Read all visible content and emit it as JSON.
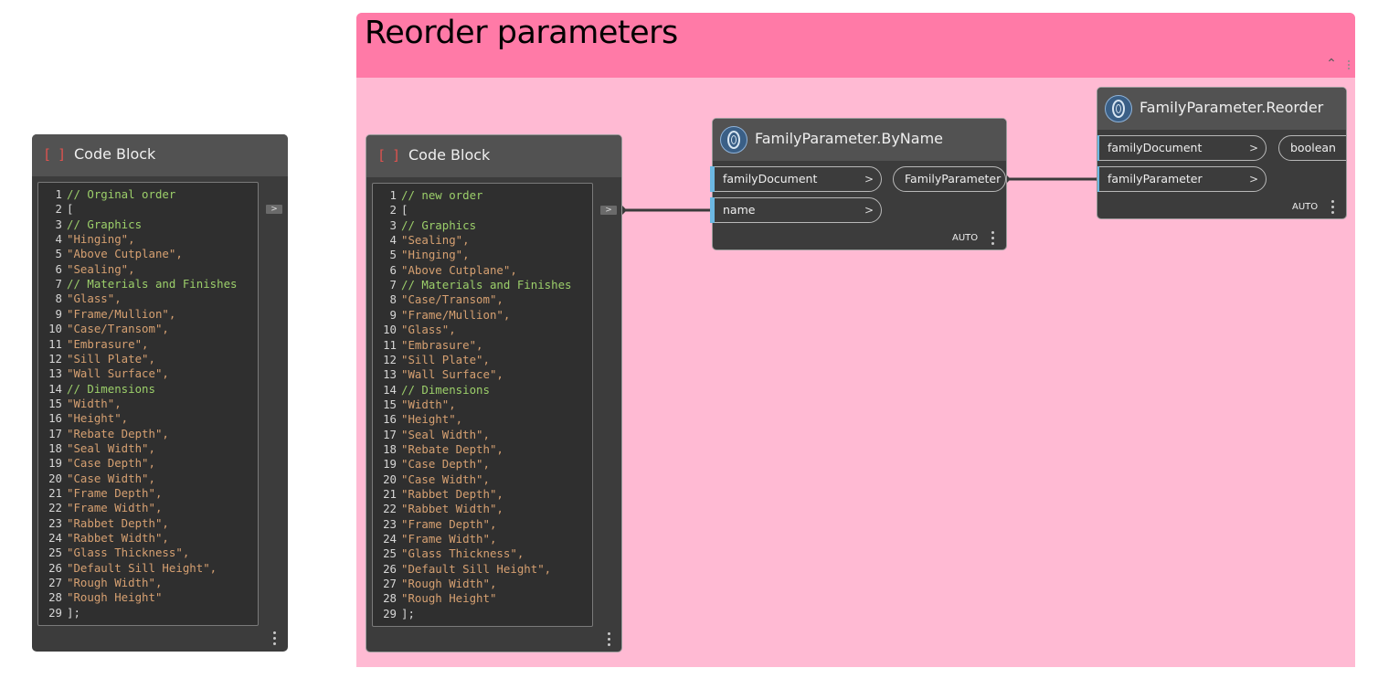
{
  "group": {
    "title": "Reorder parameters"
  },
  "nodes": {
    "code_left": {
      "title": "Code Block",
      "icon_open": "[",
      "icon_close": "]",
      "out_port": ">",
      "lines": [
        {
          "n": "1",
          "t": "// Orginal order",
          "k": "c-com"
        },
        {
          "n": "2",
          "t": "[",
          "k": "c-pun"
        },
        {
          "n": "3",
          "t": "// Graphics",
          "k": "c-com"
        },
        {
          "n": "4",
          "t": "\"Hinging\",",
          "k": "c-str"
        },
        {
          "n": "5",
          "t": "\"Above Cutplane\",",
          "k": "c-str"
        },
        {
          "n": "6",
          "t": "\"Sealing\",",
          "k": "c-str"
        },
        {
          "n": "7",
          "t": "// Materials and Finishes",
          "k": "c-com"
        },
        {
          "n": "8",
          "t": "\"Glass\",",
          "k": "c-str"
        },
        {
          "n": "9",
          "t": "\"Frame/Mullion\",",
          "k": "c-str"
        },
        {
          "n": "10",
          "t": "\"Case/Transom\",",
          "k": "c-str"
        },
        {
          "n": "11",
          "t": "\"Embrasure\",",
          "k": "c-str"
        },
        {
          "n": "12",
          "t": "\"Sill Plate\",",
          "k": "c-str"
        },
        {
          "n": "13",
          "t": "\"Wall Surface\",",
          "k": "c-str"
        },
        {
          "n": "14",
          "t": "// Dimensions",
          "k": "c-com"
        },
        {
          "n": "15",
          "t": "\"Width\",",
          "k": "c-str"
        },
        {
          "n": "16",
          "t": "\"Height\",",
          "k": "c-str"
        },
        {
          "n": "17",
          "t": "\"Rebate Depth\",",
          "k": "c-str"
        },
        {
          "n": "18",
          "t": "\"Seal Width\",",
          "k": "c-str"
        },
        {
          "n": "19",
          "t": "\"Case Depth\",",
          "k": "c-str"
        },
        {
          "n": "20",
          "t": "\"Case Width\",",
          "k": "c-str"
        },
        {
          "n": "21",
          "t": "\"Frame Depth\",",
          "k": "c-str"
        },
        {
          "n": "22",
          "t": "\"Frame Width\",",
          "k": "c-str"
        },
        {
          "n": "23",
          "t": "\"Rabbet Depth\",",
          "k": "c-str"
        },
        {
          "n": "24",
          "t": "\"Rabbet Width\",",
          "k": "c-str"
        },
        {
          "n": "25",
          "t": "\"Glass Thickness\",",
          "k": "c-str"
        },
        {
          "n": "26",
          "t": "\"Default Sill Height\",",
          "k": "c-str"
        },
        {
          "n": "27",
          "t": "\"Rough Width\",",
          "k": "c-str"
        },
        {
          "n": "28",
          "t": "\"Rough Height\"",
          "k": "c-str"
        },
        {
          "n": "29",
          "t": "];",
          "k": "c-pun"
        }
      ]
    },
    "code_right": {
      "title": "Code Block",
      "icon_open": "[",
      "icon_close": "]",
      "out_port": ">",
      "lines": [
        {
          "n": "1",
          "t": "// new order",
          "k": "c-com"
        },
        {
          "n": "2",
          "t": "[",
          "k": "c-pun"
        },
        {
          "n": "3",
          "t": "// Graphics",
          "k": "c-com"
        },
        {
          "n": "4",
          "t": "\"Sealing\",",
          "k": "c-str"
        },
        {
          "n": "5",
          "t": "\"Hinging\",",
          "k": "c-str"
        },
        {
          "n": "6",
          "t": "\"Above Cutplane\",",
          "k": "c-str"
        },
        {
          "n": "7",
          "t": "// Materials and Finishes",
          "k": "c-com"
        },
        {
          "n": "8",
          "t": "\"Case/Transom\",",
          "k": "c-str"
        },
        {
          "n": "9",
          "t": "\"Frame/Mullion\",",
          "k": "c-str"
        },
        {
          "n": "10",
          "t": "\"Glass\",",
          "k": "c-str"
        },
        {
          "n": "11",
          "t": "\"Embrasure\",",
          "k": "c-str"
        },
        {
          "n": "12",
          "t": "\"Sill Plate\",",
          "k": "c-str"
        },
        {
          "n": "13",
          "t": "\"Wall Surface\",",
          "k": "c-str"
        },
        {
          "n": "14",
          "t": "// Dimensions",
          "k": "c-com"
        },
        {
          "n": "15",
          "t": "\"Width\",",
          "k": "c-str"
        },
        {
          "n": "16",
          "t": "\"Height\",",
          "k": "c-str"
        },
        {
          "n": "17",
          "t": "\"Seal Width\",",
          "k": "c-str"
        },
        {
          "n": "18",
          "t": "\"Rebate Depth\",",
          "k": "c-str"
        },
        {
          "n": "19",
          "t": "\"Case Depth\",",
          "k": "c-str"
        },
        {
          "n": "20",
          "t": "\"Case Width\",",
          "k": "c-str"
        },
        {
          "n": "21",
          "t": "\"Rabbet Depth\",",
          "k": "c-str"
        },
        {
          "n": "22",
          "t": "\"Rabbet Width\",",
          "k": "c-str"
        },
        {
          "n": "23",
          "t": "\"Frame Depth\",",
          "k": "c-str"
        },
        {
          "n": "24",
          "t": "\"Frame Width\",",
          "k": "c-str"
        },
        {
          "n": "25",
          "t": "\"Glass Thickness\",",
          "k": "c-str"
        },
        {
          "n": "26",
          "t": "\"Default Sill Height\",",
          "k": "c-str"
        },
        {
          "n": "27",
          "t": "\"Rough Width\",",
          "k": "c-str"
        },
        {
          "n": "28",
          "t": "\"Rough Height\"",
          "k": "c-str"
        },
        {
          "n": "29",
          "t": "];",
          "k": "c-pun"
        }
      ]
    },
    "by_name": {
      "title": "FamilyParameter.ByName",
      "icon": "dynamo-revit-icon",
      "inputs": [
        "familyDocument",
        "name"
      ],
      "output": "FamilyParameter",
      "lacing": "AUTO"
    },
    "reorder": {
      "title": "FamilyParameter.Reorder",
      "icon": "dynamo-revit-icon",
      "inputs": [
        "familyDocument",
        "familyParameter"
      ],
      "output": "boolean",
      "lacing": "AUTO"
    }
  },
  "input_chevron": ">",
  "colors": {
    "group_header": "#ff7aa7",
    "group_body": "#ffbad3",
    "comment": "#9ccf6a",
    "string": "#d6a071",
    "port_bar": "#6cb8e2"
  }
}
